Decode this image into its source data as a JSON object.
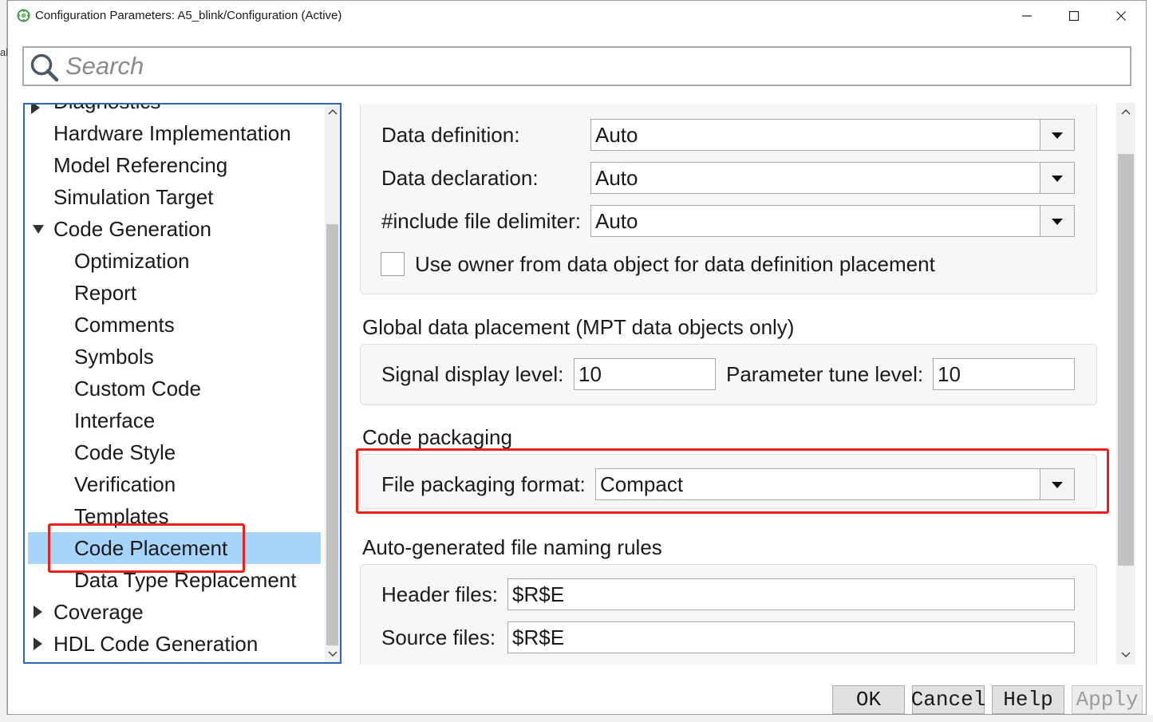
{
  "window": {
    "title": "Configuration Parameters: A5_blink/Configuration (Active)",
    "controls": {
      "minimize": "—",
      "maximize": "☐",
      "close": "✕"
    }
  },
  "background_fragment": "ak",
  "search": {
    "placeholder": "Search",
    "value": "",
    "icon": "search-icon"
  },
  "tree": {
    "items": [
      {
        "label": "Diagnostics",
        "level": 0,
        "partial": true
      },
      {
        "label": "Hardware Implementation",
        "level": 0
      },
      {
        "label": "Model Referencing",
        "level": 0
      },
      {
        "label": "Simulation Target",
        "level": 0
      },
      {
        "label": "Code Generation",
        "level": 0,
        "expanded": true
      },
      {
        "label": "Optimization",
        "level": 1
      },
      {
        "label": "Report",
        "level": 1
      },
      {
        "label": "Comments",
        "level": 1
      },
      {
        "label": "Symbols",
        "level": 1
      },
      {
        "label": "Custom Code",
        "level": 1
      },
      {
        "label": "Interface",
        "level": 1
      },
      {
        "label": "Code Style",
        "level": 1
      },
      {
        "label": "Verification",
        "level": 1
      },
      {
        "label": "Templates",
        "level": 1
      },
      {
        "label": "Code Placement",
        "level": 1,
        "selected": true
      },
      {
        "label": "Data Type Replacement",
        "level": 1
      },
      {
        "label": "Coverage",
        "level": 0,
        "collapsed": true
      },
      {
        "label": "HDL Code Generation",
        "level": 0,
        "collapsed": true
      }
    ]
  },
  "data_placement": {
    "data_definition": {
      "label": "Data definition:",
      "value": "Auto"
    },
    "data_declaration": {
      "label": "Data declaration:",
      "value": "Auto"
    },
    "include_delimiter": {
      "label": "#include file delimiter:",
      "value": "Auto"
    },
    "use_owner": {
      "label": "Use owner from data object for data definition placement",
      "checked": false
    }
  },
  "global_data_placement": {
    "title": "Global data placement (MPT data objects only)",
    "signal_display_level": {
      "label": "Signal display level:",
      "value": "10"
    },
    "parameter_tune_level": {
      "label": "Parameter tune level:",
      "value": "10"
    }
  },
  "code_packaging": {
    "title": "Code packaging",
    "file_packaging_format": {
      "label": "File packaging format:",
      "value": "Compact"
    }
  },
  "file_naming": {
    "title": "Auto-generated file naming rules",
    "header_files": {
      "label": "Header files:",
      "value": "$R$E"
    },
    "source_files": {
      "label": "Source files:",
      "value": "$R$E"
    }
  },
  "buttons": {
    "ok": "OK",
    "cancel": "Cancel",
    "help": "Help",
    "apply": "Apply"
  },
  "colors": {
    "highlight": "#e8211b",
    "selection": "#a6d4fb",
    "tree_border": "#2d66b9"
  }
}
